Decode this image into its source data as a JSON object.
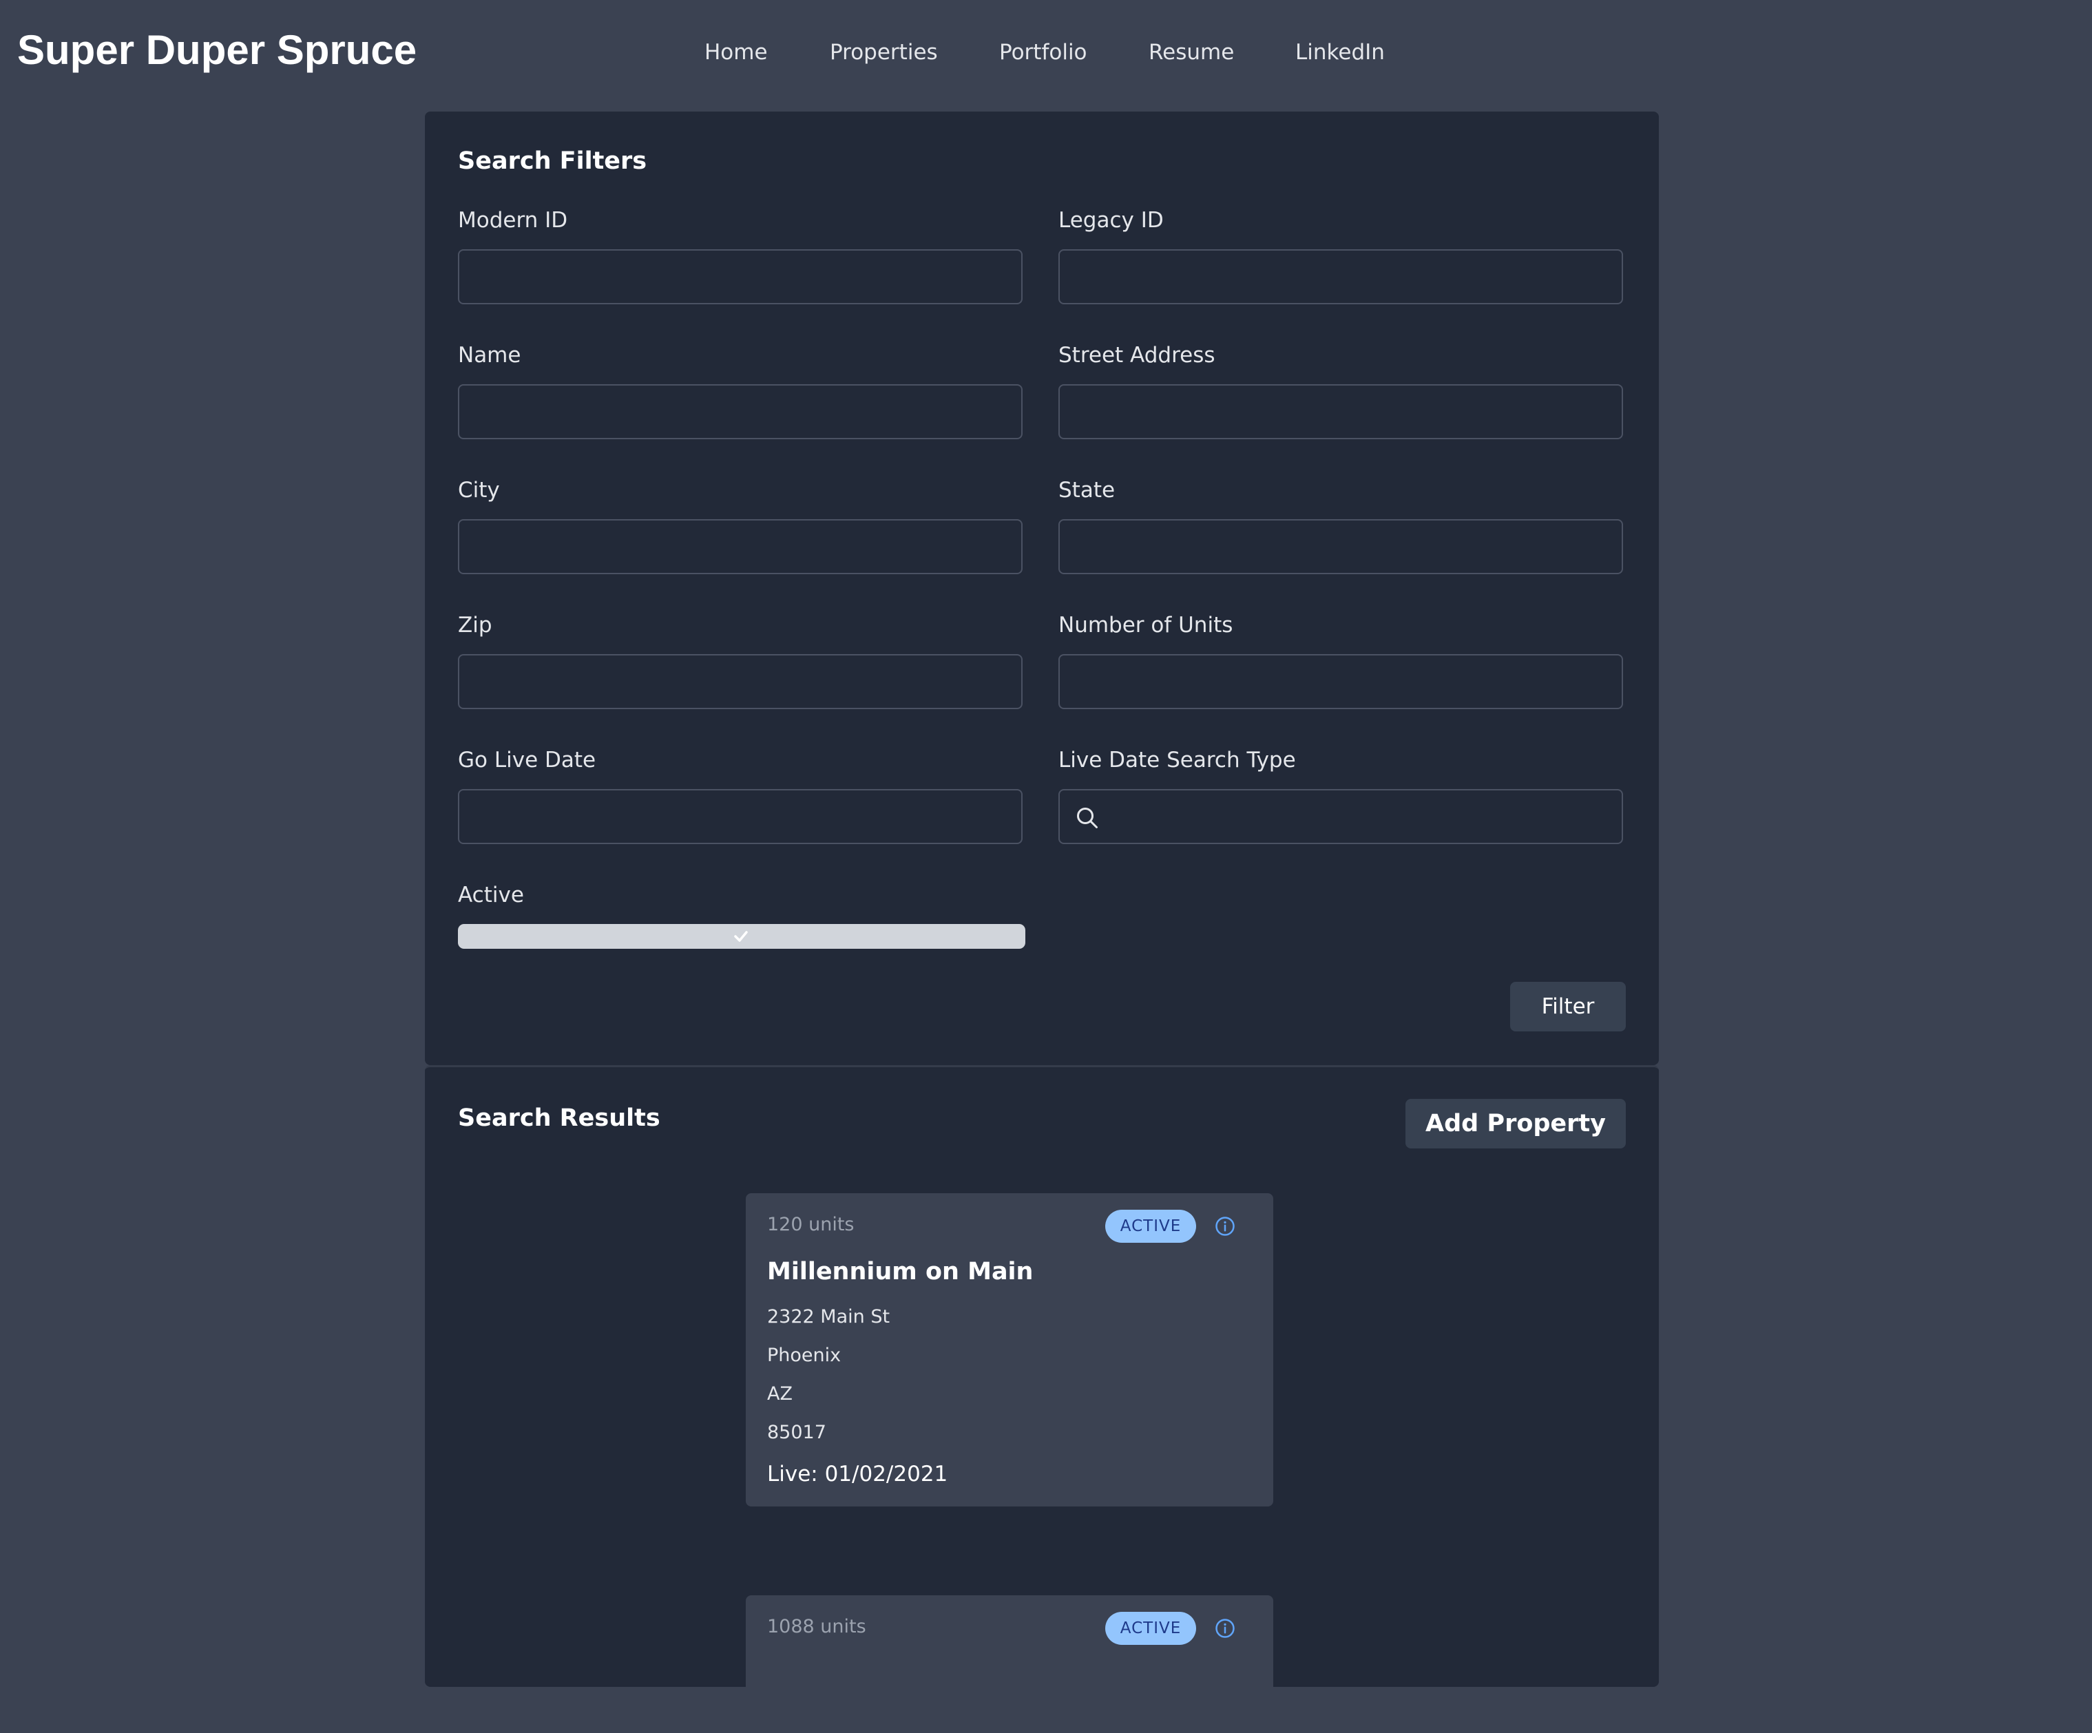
{
  "header": {
    "brand": "Super Duper Spruce",
    "nav": [
      "Home",
      "Properties",
      "Portfolio",
      "Resume",
      "LinkedIn"
    ]
  },
  "filters": {
    "title": "Search Filters",
    "fields": {
      "modern_id": {
        "label": "Modern ID",
        "value": ""
      },
      "legacy_id": {
        "label": "Legacy ID",
        "value": ""
      },
      "name": {
        "label": "Name",
        "value": ""
      },
      "street_address": {
        "label": "Street Address",
        "value": ""
      },
      "city": {
        "label": "City",
        "value": ""
      },
      "state": {
        "label": "State",
        "value": ""
      },
      "zip": {
        "label": "Zip",
        "value": ""
      },
      "number_of_units": {
        "label": "Number of Units",
        "value": ""
      },
      "go_live_date": {
        "label": "Go Live Date",
        "value": ""
      },
      "live_date_search_type": {
        "label": "Live Date Search Type",
        "value": "",
        "icon": "search-icon"
      }
    },
    "active": {
      "label": "Active",
      "checked": true,
      "icon": "checkmark-icon"
    },
    "filter_button": "Filter"
  },
  "results": {
    "title": "Search Results",
    "add_button": "Add Property",
    "cards": [
      {
        "units": "120 units",
        "status": "ACTIVE",
        "name": "Millennium on Main",
        "street": "2322 Main St",
        "city": "Phoenix",
        "state": "AZ",
        "zip": "85017",
        "live": "Live: 01/02/2021"
      },
      {
        "units": "1088 units",
        "status": "ACTIVE"
      }
    ]
  },
  "colors": {
    "page_bg": "#3b4252",
    "panel_bg": "#222938",
    "card_bg": "#3b4252",
    "badge_bg": "#93c5fd",
    "badge_text": "#1e3a8a",
    "info_icon": "#60a5fa"
  }
}
